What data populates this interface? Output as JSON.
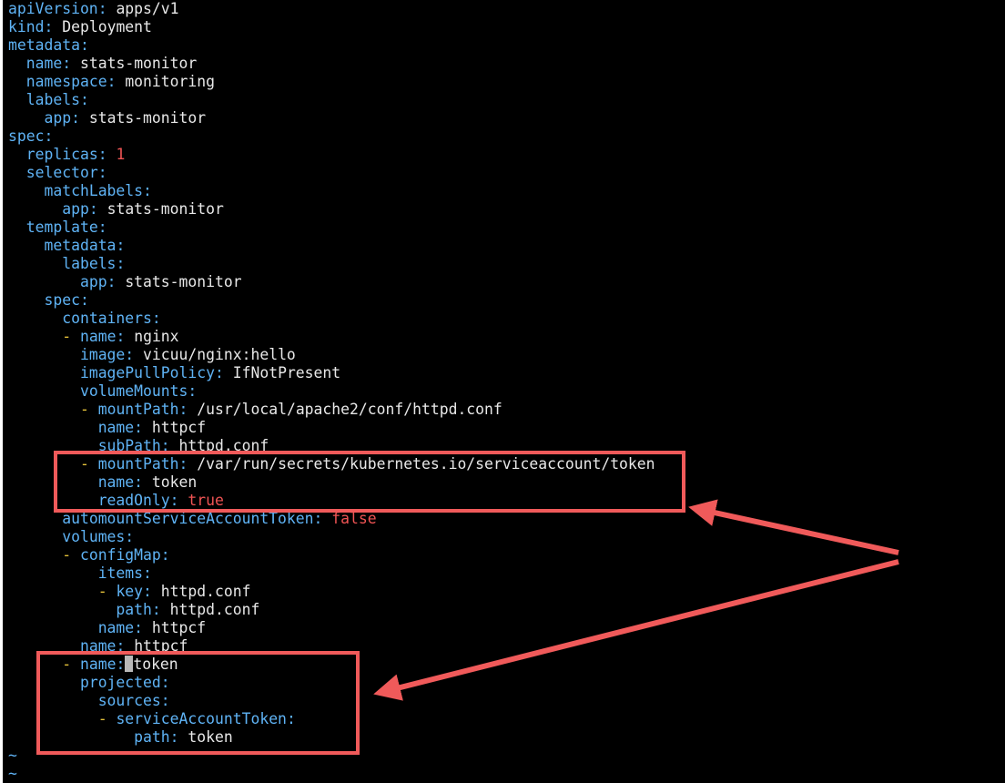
{
  "editor": {
    "lines": [
      {
        "indent": "",
        "dash": "",
        "key": "apiVersion",
        "value": "apps/v1",
        "value_type": "string"
      },
      {
        "indent": "",
        "dash": "",
        "key": "kind",
        "value": "Deployment",
        "value_type": "string"
      },
      {
        "indent": "",
        "dash": "",
        "key": "metadata",
        "value": "",
        "value_type": "string"
      },
      {
        "indent": "  ",
        "dash": "",
        "key": "name",
        "value": "stats-monitor",
        "value_type": "string"
      },
      {
        "indent": "  ",
        "dash": "",
        "key": "namespace",
        "value": "monitoring",
        "value_type": "string"
      },
      {
        "indent": "  ",
        "dash": "",
        "key": "labels",
        "value": "",
        "value_type": "string"
      },
      {
        "indent": "    ",
        "dash": "",
        "key": "app",
        "value": "stats-monitor",
        "value_type": "string"
      },
      {
        "indent": "",
        "dash": "",
        "key": "spec",
        "value": "",
        "value_type": "string"
      },
      {
        "indent": "  ",
        "dash": "",
        "key": "replicas",
        "value": "1",
        "value_type": "number"
      },
      {
        "indent": "  ",
        "dash": "",
        "key": "selector",
        "value": "",
        "value_type": "string"
      },
      {
        "indent": "    ",
        "dash": "",
        "key": "matchLabels",
        "value": "",
        "value_type": "string"
      },
      {
        "indent": "      ",
        "dash": "",
        "key": "app",
        "value": "stats-monitor",
        "value_type": "string"
      },
      {
        "indent": "  ",
        "dash": "",
        "key": "template",
        "value": "",
        "value_type": "string"
      },
      {
        "indent": "    ",
        "dash": "",
        "key": "metadata",
        "value": "",
        "value_type": "string"
      },
      {
        "indent": "      ",
        "dash": "",
        "key": "labels",
        "value": "",
        "value_type": "string"
      },
      {
        "indent": "        ",
        "dash": "",
        "key": "app",
        "value": "stats-monitor",
        "value_type": "string"
      },
      {
        "indent": "    ",
        "dash": "",
        "key": "spec",
        "value": "",
        "value_type": "string"
      },
      {
        "indent": "      ",
        "dash": "",
        "key": "containers",
        "value": "",
        "value_type": "string"
      },
      {
        "indent": "      ",
        "dash": "- ",
        "key": "name",
        "value": "nginx",
        "value_type": "string"
      },
      {
        "indent": "        ",
        "dash": "",
        "key": "image",
        "value": "vicuu/nginx:hello",
        "value_type": "string"
      },
      {
        "indent": "        ",
        "dash": "",
        "key": "imagePullPolicy",
        "value": "IfNotPresent",
        "value_type": "string"
      },
      {
        "indent": "        ",
        "dash": "",
        "key": "volumeMounts",
        "value": "",
        "value_type": "string"
      },
      {
        "indent": "        ",
        "dash": "- ",
        "key": "mountPath",
        "value": "/usr/local/apache2/conf/httpd.conf",
        "value_type": "string"
      },
      {
        "indent": "          ",
        "dash": "",
        "key": "name",
        "value": "httpcf",
        "value_type": "string"
      },
      {
        "indent": "          ",
        "dash": "",
        "key": "subPath",
        "value": "httpd.conf",
        "value_type": "string"
      },
      {
        "indent": "        ",
        "dash": "- ",
        "key": "mountPath",
        "value": "/var/run/secrets/kubernetes.io/serviceaccount/token",
        "value_type": "string"
      },
      {
        "indent": "          ",
        "dash": "",
        "key": "name",
        "value": "token",
        "value_type": "string"
      },
      {
        "indent": "          ",
        "dash": "",
        "key": "readOnly",
        "value": "true",
        "value_type": "boolean"
      },
      {
        "indent": "      ",
        "dash": "",
        "key": "automountServiceAccountToken",
        "value": "false",
        "value_type": "boolean"
      },
      {
        "indent": "      ",
        "dash": "",
        "key": "volumes",
        "value": "",
        "value_type": "string"
      },
      {
        "indent": "      ",
        "dash": "- ",
        "key": "configMap",
        "value": "",
        "value_type": "string"
      },
      {
        "indent": "          ",
        "dash": "",
        "key": "items",
        "value": "",
        "value_type": "string"
      },
      {
        "indent": "          ",
        "dash": "- ",
        "key": "key",
        "value": "httpd.conf",
        "value_type": "string"
      },
      {
        "indent": "            ",
        "dash": "",
        "key": "path",
        "value": "httpd.conf",
        "value_type": "string"
      },
      {
        "indent": "          ",
        "dash": "",
        "key": "name",
        "value": "httpcf",
        "value_type": "string"
      },
      {
        "indent": "        ",
        "dash": "",
        "key": "name",
        "value": "httpcf",
        "value_type": "string"
      },
      {
        "indent": "      ",
        "dash": "- ",
        "key": "name",
        "value": "token",
        "value_type": "string",
        "cursor": true
      },
      {
        "indent": "        ",
        "dash": "",
        "key": "projected",
        "value": "",
        "value_type": "string"
      },
      {
        "indent": "          ",
        "dash": "",
        "key": "sources",
        "value": "",
        "value_type": "string"
      },
      {
        "indent": "          ",
        "dash": "- ",
        "key": "serviceAccountToken",
        "value": "",
        "value_type": "string"
      },
      {
        "indent": "              ",
        "dash": "",
        "key": "path",
        "value": "token",
        "value_type": "string"
      }
    ],
    "empty_line_marker": "~",
    "empty_line_count": 2
  },
  "colors": {
    "background": "#000000",
    "key": "#5fb3f5",
    "value": "#e8e8e8",
    "number": "#f05454",
    "dash": "#e5c23a",
    "annotation": "#f05a5a"
  }
}
